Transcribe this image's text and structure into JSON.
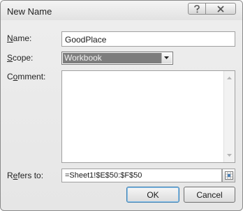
{
  "window": {
    "title": "New Name"
  },
  "title_buttons": {
    "help_icon": "question-icon",
    "close_icon": "close-icon"
  },
  "form": {
    "name_label_u": "N",
    "name_label_rest": "ame:",
    "name_value": "GoodPlace",
    "scope_label_u": "S",
    "scope_label_rest": "cope:",
    "scope_value": "Workbook",
    "comment_label_pre": "C",
    "comment_label_u": "o",
    "comment_label_rest": "mment:",
    "comment_value": "",
    "refers_label_pre": "R",
    "refers_label_u": "e",
    "refers_label_rest": "fers to:",
    "refers_value": "=Sheet1!$E$50:$F$50"
  },
  "buttons": {
    "ok_label": "OK",
    "cancel_label": "Cancel"
  },
  "colors": {
    "ok_border": "#3c7fb1",
    "selected_bg": "#7d7d7d"
  }
}
